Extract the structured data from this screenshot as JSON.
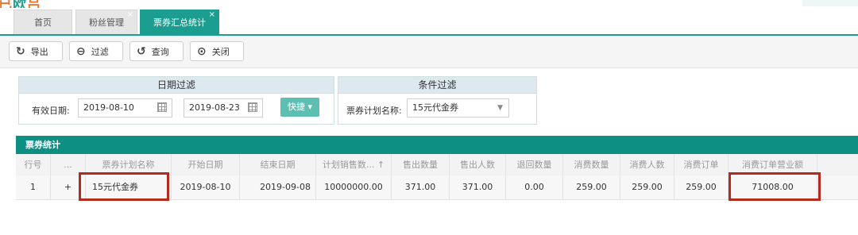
{
  "tabs": [
    {
      "label": "首页",
      "close": ""
    },
    {
      "label": "粉丝管理",
      "close": "×"
    },
    {
      "label": "票券汇总统计",
      "close": "×"
    }
  ],
  "toolbar": {
    "export_label": "导出",
    "filter_label": "过滤",
    "query_label": "查询",
    "close_label": "关闭"
  },
  "date_filter": {
    "title": "日期过滤",
    "valid_date_label": "有效日期:",
    "start_date": "2019-08-10",
    "to_label": "至:",
    "end_date": "2019-08-23",
    "quick_label": "快捷 ▾"
  },
  "condition_filter": {
    "title": "条件过滤",
    "plan_name_label": "票券计划名称:",
    "plan_name_value": "15元代金券"
  },
  "grid": {
    "title": "票券统计",
    "headers": [
      "行号",
      "...",
      "票券计划名称",
      "开始日期",
      "结束日期",
      "计划销售数... ↑",
      "售出数量",
      "售出人数",
      "退回数量",
      "消费数量",
      "消费人数",
      "消费订单",
      "消费订单营业额"
    ],
    "row": [
      "1",
      "+",
      "15元代金券",
      "2019-08-10",
      "2019-09-08",
      "10000000.00",
      "371.00",
      "371.00",
      "0.00",
      "259.00",
      "259.00",
      "259.00",
      "71008.00"
    ]
  },
  "colors": {
    "accent": "#1b9e90",
    "highlight": "#b32a1e"
  }
}
